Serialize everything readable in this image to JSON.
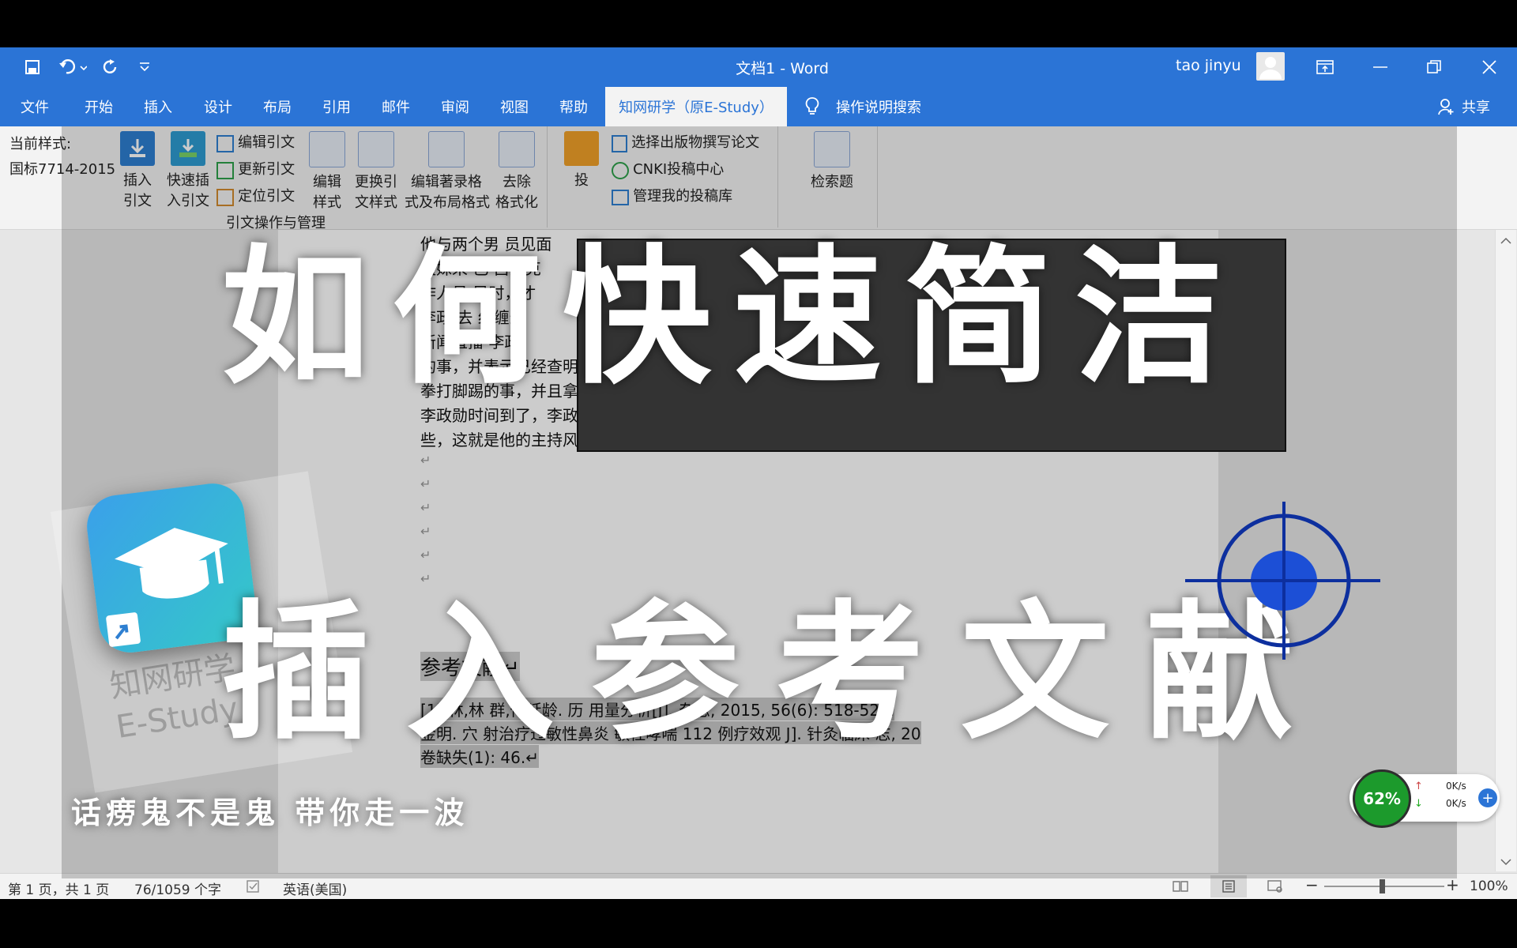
{
  "window": {
    "title": "文档1  -  Word",
    "user": "tao jinyu"
  },
  "tabs": [
    "文件",
    "开始",
    "插入",
    "设计",
    "布局",
    "引用",
    "邮件",
    "审阅",
    "视图",
    "帮助"
  ],
  "active_tab": "知网研学（原E-Study）",
  "tell_me": "操作说明搜索",
  "share": "共享",
  "ribbon": {
    "current_style_label": "当前样式:",
    "current_style_value": "国标7714-2015",
    "insert_citation": [
      "插入",
      "引文"
    ],
    "quick_insert": [
      "快速插",
      "入引文"
    ],
    "edit_citation": "编辑引文",
    "update_citation": "更新引文",
    "locate_citation": "定位引文",
    "edit_style": [
      "编辑",
      "样式"
    ],
    "change_style": [
      "更换引",
      "文样式"
    ],
    "edit_bib_layout": [
      "编辑著录格",
      "式及布局格式"
    ],
    "remove_format": [
      "去除",
      "格式化"
    ],
    "group_label": "引文操作与管理",
    "submit": "投",
    "select_pub": "选择出版物撰写论文",
    "cnki_center": "CNKI投稿中心",
    "manage_submission": "管理我的投稿库",
    "search_title": "检索题"
  },
  "doc": {
    "lines": [
      "他与两个男    员见面",
      "姐妹来    己  吕河克",
      "  作人员    导时，才",
      "李政   去   纠缠过",
      "  新闻直播      李政",
      "的事，并表示已经查明",
      "拳打脚踢的事，并且拿",
      "李政勋时间到了，李政勋这才结束了直播，这件事让吴会长非常难堪，可李政勋并未顾及这",
      "些，这就是他的主持风格。↵"
    ],
    "empty_marks": [
      "↵",
      "↵",
      "↵",
      "↵",
      "↵",
      "↵"
    ],
    "ref_heading": "参考文献↵",
    "refs": [
      "[1]   林,林   群,傅延龄. 历   用量分析[J].     杂志, 2015, 56(6): 518-521.",
      "    金明. 穴   射治疗过敏性鼻炎   敏性哮喘 112 例疗效观   J]. 针灸临床   志, 20",
      "卷缺失(1): 46.↵"
    ]
  },
  "overlay": {
    "headline1": "如何快速简洁",
    "headline2": "插入参考文献",
    "caption": "话痨鬼不是鬼  带你走一波",
    "watermark": "知网研学\nE-Study"
  },
  "status": {
    "page": "第 1 页，共 1 页",
    "words": "76/1059 个字",
    "lang": "英语(美国)",
    "zoom": "100%"
  },
  "net_meter": {
    "percent": "62%",
    "up": "0K/s",
    "down": "0K/s"
  },
  "colors": {
    "accent": "#2b74d6",
    "ribbon_bg": "#f3f3f3",
    "target_blue": "#0d2f9e",
    "meter_green": "#1c9a2c"
  }
}
